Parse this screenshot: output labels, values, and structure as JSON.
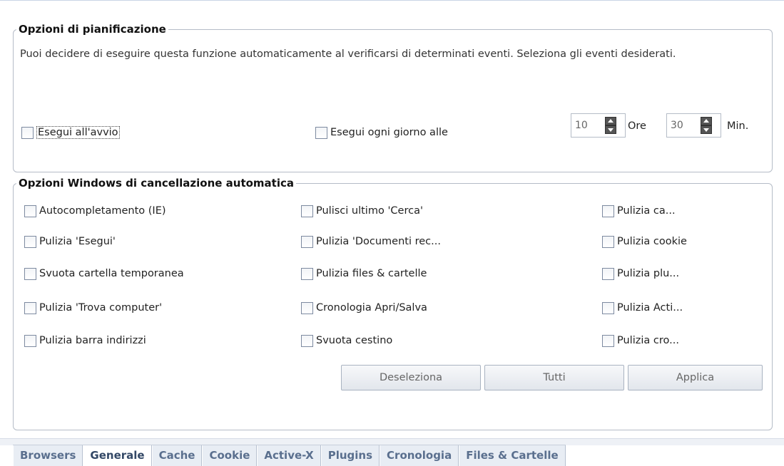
{
  "scheduling": {
    "legend": "Opzioni di pianificazione",
    "description": "Puoi decidere di eseguire questa funzione automaticamente al verificarsi di determinati eventi. Seleziona gli eventi desiderati.",
    "run_at_startup": "Esegui all'avvio",
    "run_daily_at": "Esegui ogni giorno alle",
    "hour_value": "10",
    "hour_unit": "Ore",
    "minute_value": "30",
    "minute_unit": "Min."
  },
  "windows_options": {
    "legend": "Opzioni Windows di cancellazione automatica",
    "col1": [
      "Autocompletamento (IE)",
      "Pulizia 'Esegui'",
      "Svuota cartella temporanea",
      "Pulizia 'Trova computer'",
      "Pulizia barra indirizzi"
    ],
    "col2": [
      "Pulisci ultimo 'Cerca'",
      "Pulizia 'Documenti rec...",
      "Pulizia files & cartelle",
      "Cronologia Apri/Salva",
      "Svuota cestino"
    ],
    "col3": [
      "Pulizia ca...",
      "Pulizia cookie",
      "Pulizia plu...",
      "Pulizia Acti...",
      "Pulizia cro..."
    ]
  },
  "buttons": {
    "deselect": "Deseleziona",
    "all": "Tutti",
    "apply": "Applica"
  },
  "tabs": [
    "Browsers",
    "Generale",
    "Cache",
    "Cookie",
    "Active-X",
    "Plugins",
    "Cronologia",
    "Files & Cartelle"
  ],
  "active_tab": "Generale"
}
